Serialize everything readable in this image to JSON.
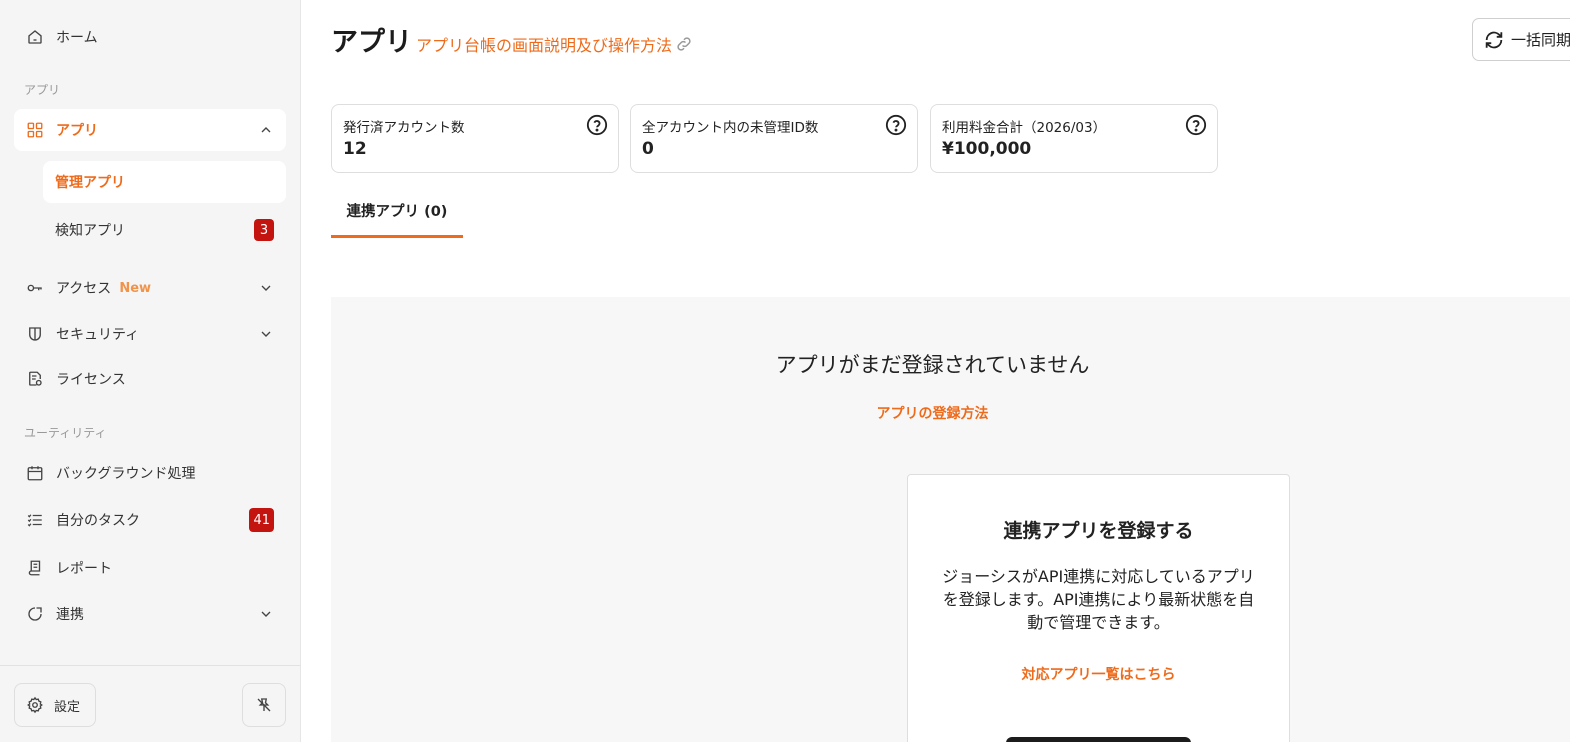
{
  "sidebar": {
    "home_label": "ホーム",
    "section_apps": "アプリ",
    "apps_label": "アプリ",
    "managed_apps_label": "管理アプリ",
    "detected_apps_label": "検知アプリ",
    "detected_apps_badge": "3",
    "access_label": "アクセス",
    "access_new_tag": "New",
    "security_label": "セキュリティ",
    "license_label": "ライセンス",
    "section_utility": "ユーティリティ",
    "background_label": "バックグラウンド処理",
    "tasks_label": "自分のタスク",
    "tasks_badge": "41",
    "report_label": "レポート",
    "integration_label": "連携",
    "settings_label": "設定"
  },
  "header": {
    "title": "アプリ",
    "help_link": "アプリ台帳の画面説明及び操作方法",
    "sync_button": "一括同期"
  },
  "stats": [
    {
      "label": "発行済アカウント数",
      "value": "12"
    },
    {
      "label": "全アカウント内の未管理ID数",
      "value": "0"
    },
    {
      "label": "利用料金合計（2026/03）",
      "value": "¥100,000"
    }
  ],
  "tabs": {
    "integrated_apps": "連携アプリ (0)"
  },
  "empty_state": {
    "title": "アプリがまだ登録されていません",
    "how_to_link": "アプリの登録方法"
  },
  "register_card": {
    "title": "連携アプリを登録する",
    "description": "ジョーシスがAPI連携に対応しているアプリを登録します。API連携により最新状態を自動で管理できます。",
    "supported_link": "対応アプリ一覧はこちら"
  },
  "colors": {
    "accent": "#ee6b1b",
    "badge": "#c4140f",
    "sidebar_bg": "#f5f5f5"
  }
}
